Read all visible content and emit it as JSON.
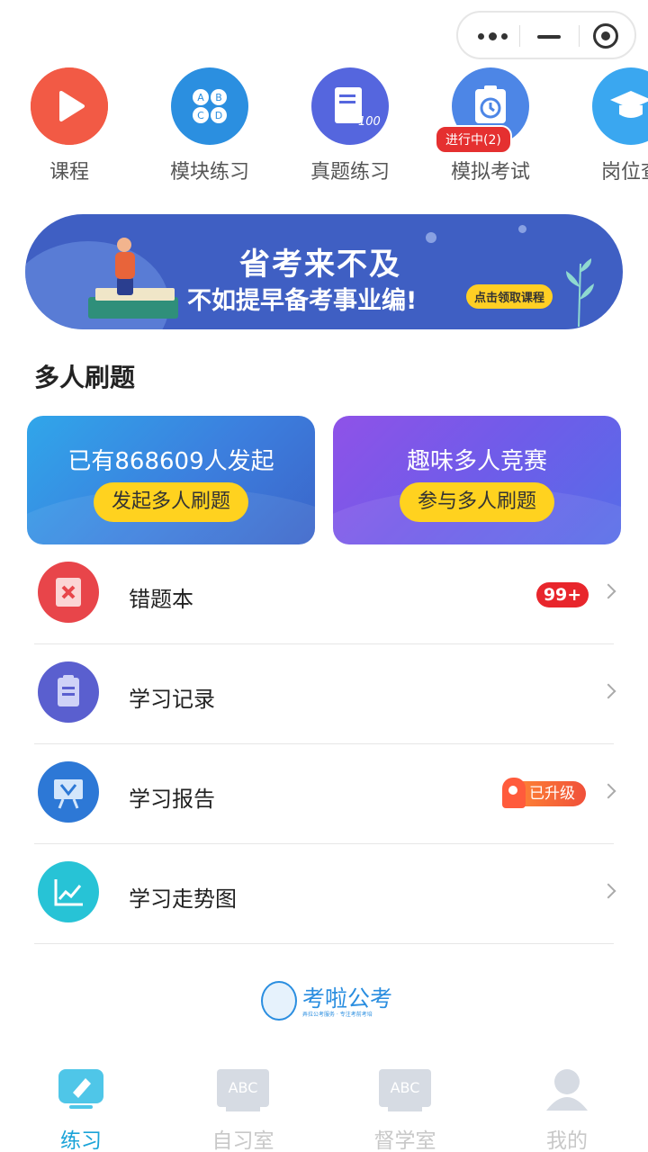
{
  "top_icons": [
    {
      "label": "课程",
      "icon": "play-icon",
      "color": "#f0533f"
    },
    {
      "label": "模块练习",
      "icon": "abcd-grid-icon",
      "color": "#2f8fe0"
    },
    {
      "label": "真题练习",
      "icon": "scroll-100-icon",
      "color": "#5969e0"
    },
    {
      "label": "模拟考试",
      "icon": "clock-board-icon",
      "color": "#4f86e8",
      "badge": "进行中(2)"
    },
    {
      "label": "岗位查",
      "icon": "graduation-cap-icon",
      "color": "#3aa8f0"
    }
  ],
  "banner": {
    "line1": "省考来不及",
    "line2": "不如提早备考事业编!",
    "button": "点击领取课程"
  },
  "section": {
    "title": "多人刷题"
  },
  "cards": [
    {
      "title": "已有868609人发起",
      "button": "发起多人刷题"
    },
    {
      "title": "趣味多人竞赛",
      "button": "参与多人刷题"
    }
  ],
  "list": [
    {
      "label": "错题本",
      "icon": "wrong-book-icon",
      "badge": "99+"
    },
    {
      "label": "学习记录",
      "icon": "clipboard-icon"
    },
    {
      "label": "学习报告",
      "icon": "report-board-icon",
      "badge": "已升级"
    },
    {
      "label": "学习走势图",
      "icon": "trend-chart-icon"
    }
  ],
  "logo": {
    "name": "考啦公考",
    "sub": "弄拉公考服务 · 专注考前考培"
  },
  "tabs": [
    {
      "label": "练习",
      "icon": "practice-icon",
      "active": true
    },
    {
      "label": "自习室",
      "icon": "study-room-icon",
      "abc": "ABC"
    },
    {
      "label": "督学室",
      "icon": "supervise-room-icon",
      "abc": "ABC"
    },
    {
      "label": "我的",
      "icon": "profile-icon"
    }
  ]
}
